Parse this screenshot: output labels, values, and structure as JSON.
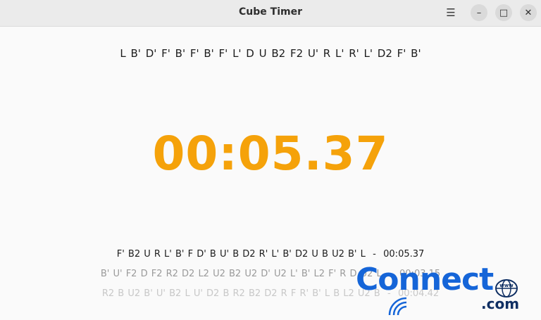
{
  "window": {
    "title": "Cube Timer"
  },
  "icons": {
    "menu": "☰",
    "minimize": "–",
    "maximize": "□",
    "close": "✕"
  },
  "scramble": "L B' D' F' B' F' B' F' L' D U B2 F2 U' R L' R' L' D2 F' B'",
  "timer": "00:05.37",
  "history": [
    {
      "scramble": "F' B2 U R L' B' F D' B U' B D2 R' L' B' D2 U B U2 B' L",
      "time": "00:05.37"
    },
    {
      "scramble": "B' U' F2 D F2 R2 D2 L2 U2 B2 U2 D' U2 L' B' L2 F' R D U2 L",
      "time": "00:03.15"
    },
    {
      "scramble": "R2 B U2 B' U' B2 L U' D2 B R2 B2 D2 R F R' B' L B L2 U2 B",
      "time": "00:04.42"
    }
  ],
  "watermark": {
    "brand": "Connect",
    "suffix": ".com",
    "globe_label": "www",
    "brand_color": "#1565d8"
  },
  "colors": {
    "timer": "#f5a20a"
  }
}
